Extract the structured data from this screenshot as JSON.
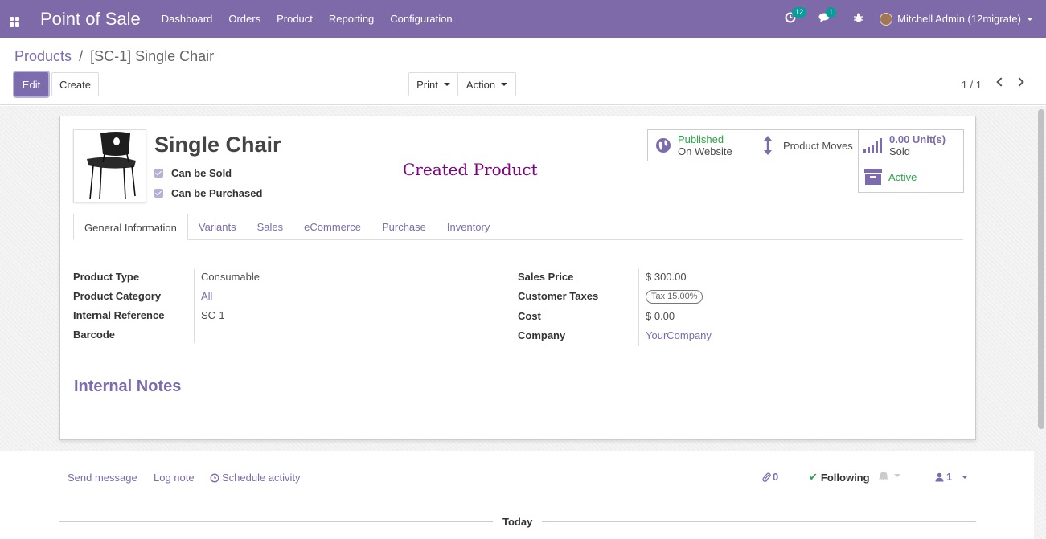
{
  "navbar": {
    "brand": "Point of Sale",
    "menu": [
      "Dashboard",
      "Orders",
      "Product",
      "Reporting",
      "Configuration"
    ],
    "activity_count": "12",
    "message_count": "1",
    "user": "Mitchell Admin (12migrate)",
    "color": "#7e6aa8"
  },
  "breadcrumb": {
    "parent": "Products",
    "separator": "/",
    "current": "[SC-1] Single Chair"
  },
  "buttons": {
    "edit": "Edit",
    "create": "Create",
    "print": "Print",
    "action": "Action"
  },
  "pager": "1 / 1",
  "product": {
    "name": "Single Chair",
    "can_be_sold": "Can be Sold",
    "can_be_purchased": "Can be Purchased",
    "annotation": "Created Product"
  },
  "stats": {
    "published_line1": "Published",
    "published_line2": "On Website",
    "moves": "Product Moves",
    "sold_value": "0.00 Unit(s)",
    "sold_label": "Sold",
    "active": "Active"
  },
  "tabs": [
    "General Information",
    "Variants",
    "Sales",
    "eCommerce",
    "Purchase",
    "Inventory"
  ],
  "left_fields": [
    {
      "label": "Product Type",
      "value": "Consumable"
    },
    {
      "label": "Product Category",
      "value": "All"
    },
    {
      "label": "Internal Reference",
      "value": "SC-1"
    },
    {
      "label": "Barcode",
      "value": ""
    }
  ],
  "right_fields": [
    {
      "label": "Sales Price",
      "value": "$ 300.00"
    },
    {
      "label": "Customer Taxes",
      "value": "Tax 15.00%"
    },
    {
      "label": "Cost",
      "value": "$ 0.00"
    },
    {
      "label": "Company",
      "value": "YourCompany"
    }
  ],
  "notes_title": "Internal Notes",
  "chatter": {
    "send_message": "Send message",
    "log_note": "Log note",
    "schedule_activity": "Schedule activity",
    "attachments": "0",
    "following": "Following",
    "followers": "1",
    "today": "Today"
  },
  "colors": {
    "accent": "#7c6cae",
    "success": "#28a745",
    "annotation": "#800080"
  }
}
